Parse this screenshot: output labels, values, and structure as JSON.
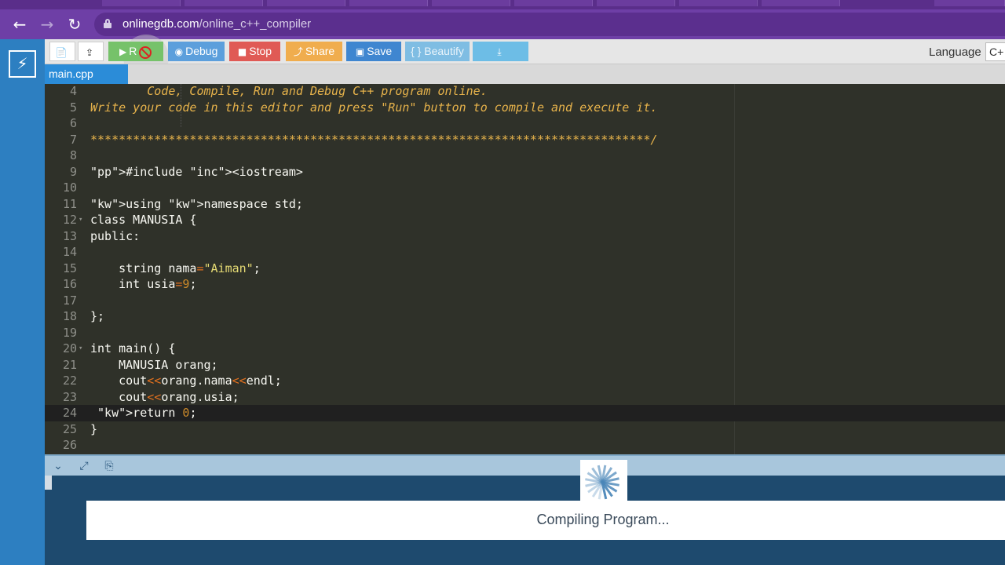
{
  "browser": {
    "url_host": "onlinegdb.com",
    "url_path": "/online_c++_compiler",
    "back_icon": "arrow-left-icon",
    "forward_icon": "arrow-right-icon",
    "reload_icon": "reload-icon"
  },
  "toolbar": {
    "run_label": "R",
    "debug_label": "Debug",
    "stop_label": "Stop",
    "share_label": "Share",
    "save_label": "Save",
    "beautify_label": "{ } Beautify",
    "language_label": "Language",
    "language_value": "C+"
  },
  "file_tab": "main.cpp",
  "editor": {
    "lines": [
      {
        "n": "4",
        "text": "        Code, Compile, Run and Debug C++ program online."
      },
      {
        "n": "5",
        "text": "Write your code in this editor and press \"Run\" button to compile and execute it."
      },
      {
        "n": "6",
        "text": ""
      },
      {
        "n": "7",
        "text": "*******************************************************************************/"
      },
      {
        "n": "8",
        "text": ""
      },
      {
        "n": "9",
        "text": "#include <iostream>"
      },
      {
        "n": "10",
        "text": ""
      },
      {
        "n": "11",
        "text": "using namespace std;"
      },
      {
        "n": "12",
        "text": "class MANUSIA {"
      },
      {
        "n": "13",
        "text": "public:"
      },
      {
        "n": "14",
        "text": ""
      },
      {
        "n": "15",
        "text": "    string nama=\"Aiman\";"
      },
      {
        "n": "16",
        "text": "    int usia=9;"
      },
      {
        "n": "17",
        "text": ""
      },
      {
        "n": "18",
        "text": "};"
      },
      {
        "n": "19",
        "text": ""
      },
      {
        "n": "20",
        "text": "int main() {"
      },
      {
        "n": "21",
        "text": "    MANUSIA orang;"
      },
      {
        "n": "22",
        "text": "    cout<<orang.nama<<endl;"
      },
      {
        "n": "23",
        "text": "    cout<<orang.usia;"
      },
      {
        "n": "24",
        "text": " return 0;"
      },
      {
        "n": "25",
        "text": "}"
      },
      {
        "n": "26",
        "text": ""
      }
    ]
  },
  "status": {
    "compiling_message": "Compiling Program..."
  },
  "colors": {
    "browser_purple": "#6e3fa6",
    "sidebar_blue": "#2d7fc1",
    "editor_bg": "#2f3129",
    "run_green": "#76c26a",
    "stop_red": "#e05a55",
    "share_orange": "#f0ad4e",
    "save_blue": "#3f86d0"
  }
}
